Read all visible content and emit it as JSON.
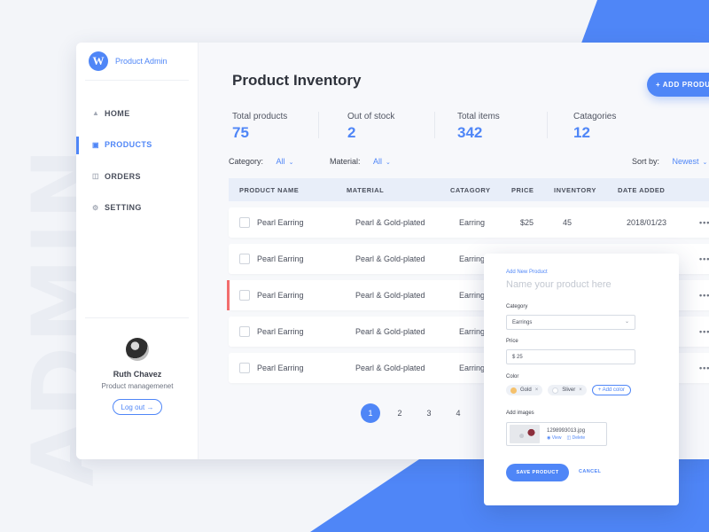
{
  "background": {
    "watermark": "ADMIN"
  },
  "colors": {
    "accent": "#4f86f7",
    "highlight_row": "#f26d6d"
  },
  "app": {
    "logo_letter": "W",
    "name": "Product Admin"
  },
  "sidebar": {
    "items": [
      {
        "label": "HOME",
        "icon": "home-icon"
      },
      {
        "label": "PRODUCTS",
        "icon": "briefcase-icon"
      },
      {
        "label": "ORDERS",
        "icon": "cart-icon"
      },
      {
        "label": "SETTING",
        "icon": "gear-icon"
      }
    ],
    "active": "PRODUCTS"
  },
  "profile": {
    "name": "Ruth Chavez",
    "role": "Product managemenet",
    "logout_label": "Log out"
  },
  "header": {
    "title": "Product Inventory",
    "add_button": "+ ADD PRODUCT"
  },
  "stats": [
    {
      "label": "Total products",
      "value": "75"
    },
    {
      "label": "Out of stock",
      "value": "2"
    },
    {
      "label": "Total items",
      "value": "342"
    },
    {
      "label": "Catagories",
      "value": "12"
    }
  ],
  "filters": {
    "category_label": "Category:",
    "category_value": "All",
    "material_label": "Material:",
    "material_value": "All",
    "sort_label": "Sort by:",
    "sort_value": "Newest"
  },
  "table": {
    "columns": [
      "PRODUCT NAME",
      "MATERIAL",
      "CATAGORY",
      "PRICE",
      "INVENTORY",
      "DATE ADDED"
    ],
    "rows": [
      {
        "name": "Pearl Earring",
        "material": "Pearl & Gold-plated",
        "category": "Earring",
        "price": "$25",
        "inventory": "45",
        "date": "2018/01/23"
      },
      {
        "name": "Pearl Earring",
        "material": "Pearl & Gold-plated",
        "category": "Earring",
        "price": "",
        "inventory": "",
        "date": ""
      },
      {
        "name": "Pearl Earring",
        "material": "Pearl & Gold-plated",
        "category": "Earring",
        "price": "",
        "inventory": "",
        "date": ""
      },
      {
        "name": "Pearl Earring",
        "material": "Pearl & Gold-plated",
        "category": "Earring",
        "price": "",
        "inventory": "",
        "date": ""
      },
      {
        "name": "Pearl Earring",
        "material": "Pearl & Gold-plated",
        "category": "Earring",
        "price": "",
        "inventory": "",
        "date": ""
      }
    ],
    "more_label": "•••"
  },
  "pagination": {
    "pages": [
      "1",
      "2",
      "3",
      "4",
      "..."
    ],
    "current": "1"
  },
  "add_panel": {
    "title": "Add New Product",
    "name_placeholder": "Name your product here",
    "category_label": "Category",
    "category_value": "Earrings",
    "price_label": "Price",
    "price_value": "$ 25",
    "color_label": "Color",
    "colors": [
      {
        "name": "Gold",
        "swatch": "#f5c16c"
      },
      {
        "name": "Sliver",
        "swatch": "#eef1f6"
      }
    ],
    "add_color_label": "+ Add color",
    "images_label": "Add images",
    "image": {
      "file": "1298993013.jpg",
      "view_label": "View",
      "delete_label": "Delete"
    },
    "save_label": "SAVE PRODUCT",
    "cancel_label": "CANCEL"
  }
}
